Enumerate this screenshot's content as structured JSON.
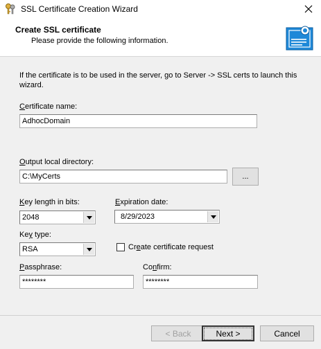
{
  "window": {
    "title": "SSL Certificate Creation Wizard"
  },
  "header": {
    "title": "Create SSL certificate",
    "subtitle": "Please provide the following information.",
    "icon": "certificate-icon"
  },
  "intro_text": "If the certificate is to be used in the server, go to Server -> SSL certs to launch this wizard.",
  "form": {
    "cert_name": {
      "label_first": "C",
      "label_rest": "ertificate name:",
      "value": "AdhocDomain"
    },
    "output_dir": {
      "label_first": "O",
      "label_rest": "utput local directory:",
      "value": "C:\\MyCerts",
      "browse_label": "..."
    },
    "key_length": {
      "label_first": "K",
      "label_rest": "ey length in bits:",
      "value": "2048"
    },
    "expiration": {
      "label_first": "E",
      "label_rest": "xpiration date:",
      "value": "8/29/2023"
    },
    "key_type": {
      "label_prefix": "Ke",
      "label_underlined": "y",
      "label_rest": " type:",
      "value": "RSA"
    },
    "create_request": {
      "label_prefix": "Cr",
      "label_underlined": "e",
      "label_rest": "ate certificate request",
      "checked": false
    },
    "passphrase": {
      "label_first": "P",
      "label_rest": "assphrase:",
      "value": "********"
    },
    "confirm": {
      "label_prefix": "Co",
      "label_underlined": "n",
      "label_rest": "firm:",
      "value": "********"
    }
  },
  "buttons": {
    "back": "< Back",
    "next": "Next >",
    "cancel": "Cancel"
  }
}
